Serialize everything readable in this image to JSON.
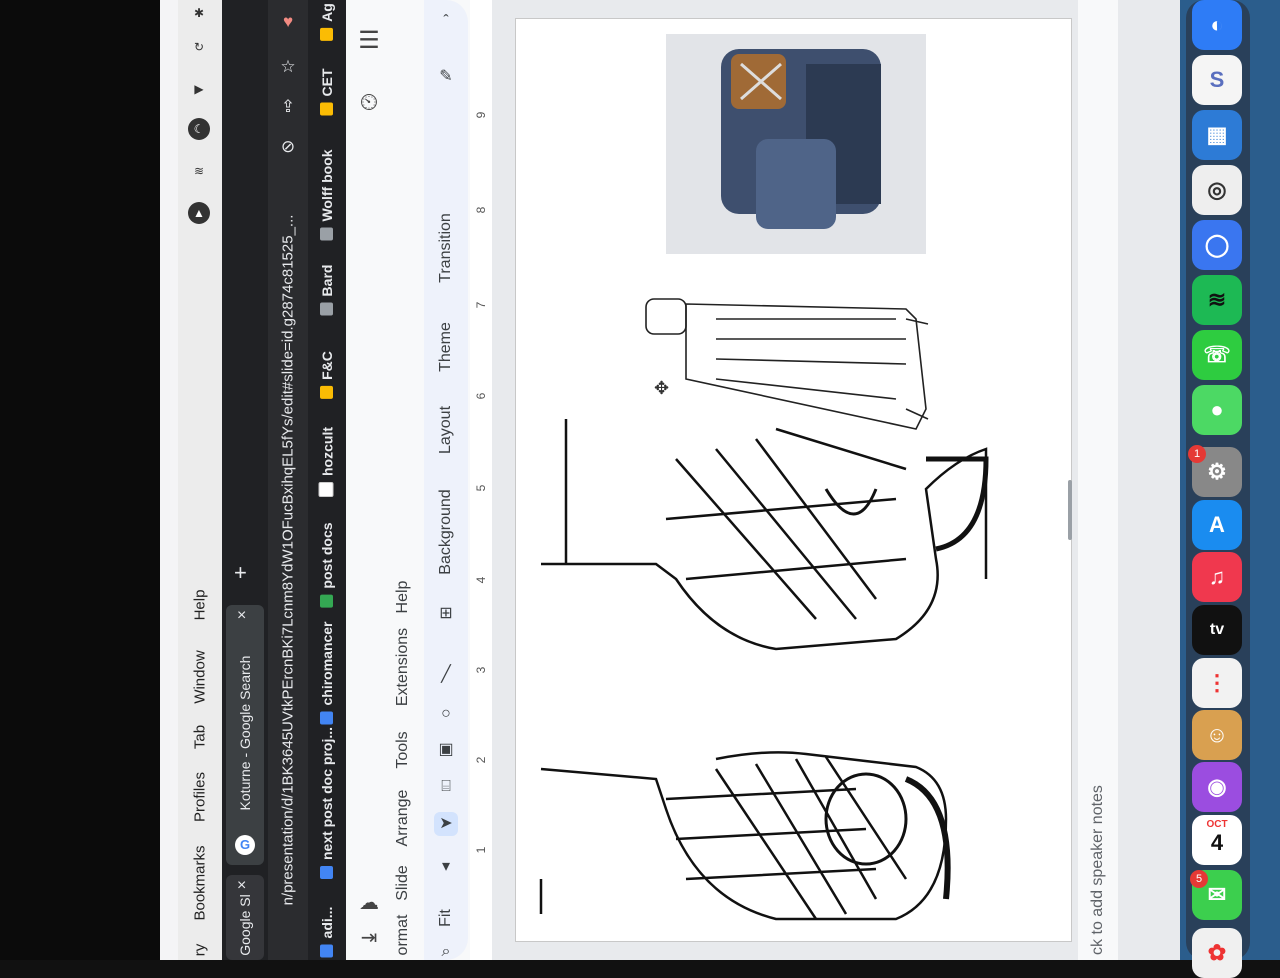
{
  "menubar": {
    "items": [
      "ry",
      "Bookmarks",
      "Profiles",
      "Tab",
      "Window",
      "Help"
    ]
  },
  "tabs": [
    {
      "label": "Google Sl",
      "close": "×"
    },
    {
      "label": "Koturne - Google Search",
      "close": "×"
    }
  ],
  "new_tab": "+",
  "address": {
    "url": "n/presentation/d/1BK3645UVtkPErcnBKi7Lcnm8YdW1OFucBxihqEL5fYs/edit#slide=id.g2874c81525_..."
  },
  "bookmarks": [
    {
      "label": "adi...",
      "color": "#4285f4"
    },
    {
      "label": "next post doc proj...",
      "color": "#4285f4"
    },
    {
      "label": "chiromancer",
      "color": "#4285f4"
    },
    {
      "label": "post docs",
      "color": "#34a853"
    },
    {
      "label": "hozcult",
      "color": "#fbbc04"
    },
    {
      "label": "F&C",
      "color": "#fbbc04"
    },
    {
      "label": "Bard",
      "color": "#9aa0a6"
    },
    {
      "label": "Wolff book",
      "color": "#9aa0a6"
    },
    {
      "label": "CET",
      "color": "#fbbc04"
    },
    {
      "label": "Ag",
      "color": "#fbbc04"
    }
  ],
  "app_menu": [
    "ormat",
    "Slide",
    "Arrange",
    "Tools",
    "Extensions",
    "Help"
  ],
  "toolbar": {
    "zoom": "Fit",
    "buttons": [
      "Background",
      "Layout",
      "Theme",
      "Transition"
    ]
  },
  "ruler": [
    "1",
    "2",
    "3",
    "4",
    "5",
    "6",
    "7",
    "8",
    "9"
  ],
  "notes": {
    "placeholder": "ck to add speaker notes"
  },
  "dock": {
    "calendar_month": "OCT",
    "calendar_day": "4",
    "messages_badge": "5",
    "app_badge": "1",
    "tv_label": "tv"
  }
}
